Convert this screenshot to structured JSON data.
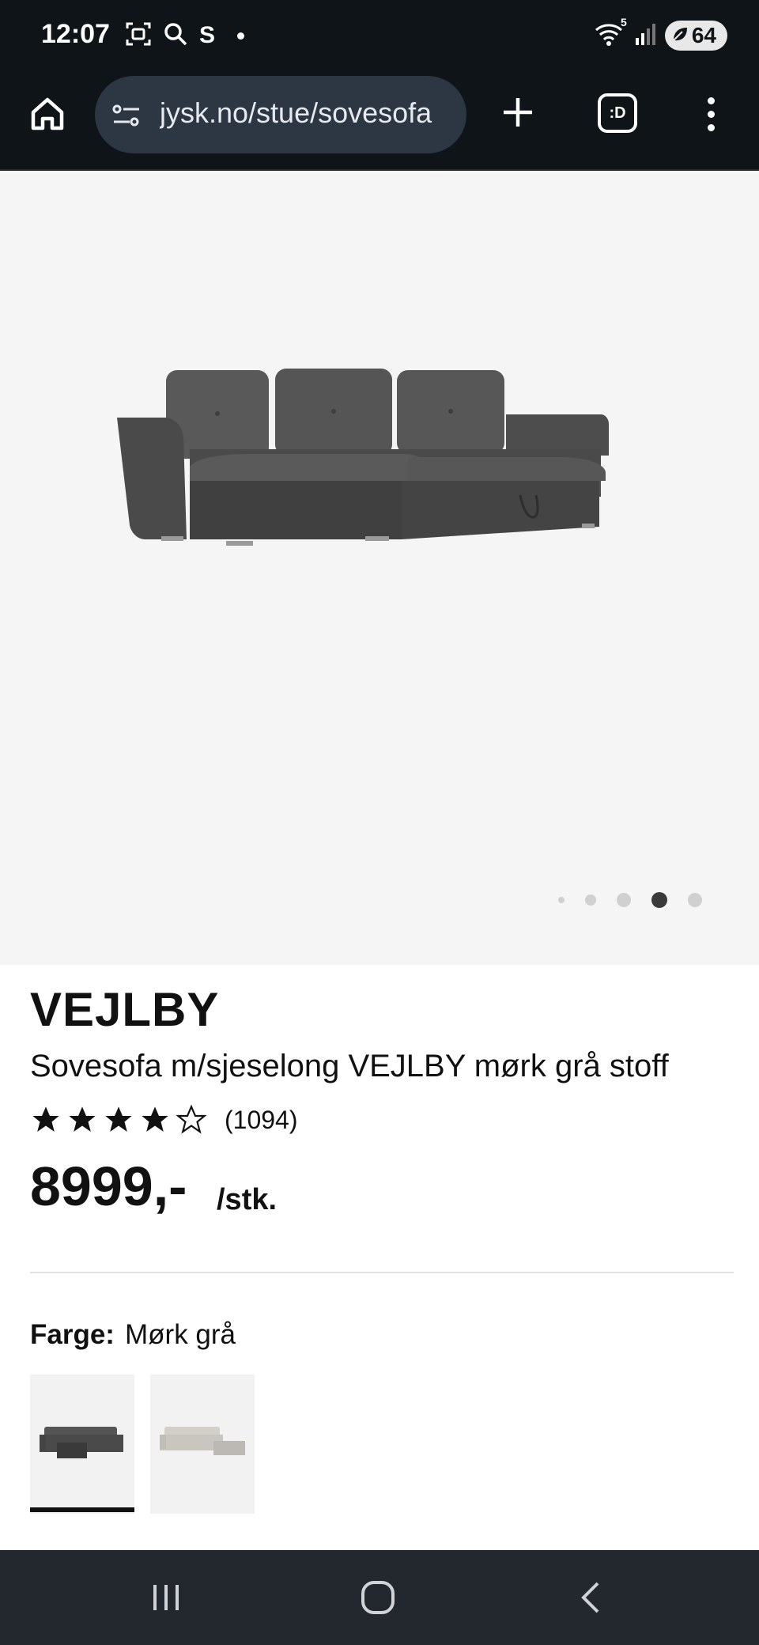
{
  "status_bar": {
    "time": "12:07",
    "app_icon_letter": "S",
    "wifi_badge": "5",
    "battery": "64"
  },
  "browser": {
    "url": "jysk.no/stue/sovesofa",
    "tab_count_label": ":D"
  },
  "gallery": {
    "page_count": 5,
    "active_index": 3
  },
  "product": {
    "name": "VEJLBY",
    "description": "Sovesofa m/sjeselong VEJLBY mørk grå stoff",
    "rating": 4,
    "rating_max": 5,
    "review_count": "(1094)",
    "price": "8999,-",
    "unit": "/stk.",
    "color_label": "Farge:",
    "color_value": "Mørk grå"
  },
  "colors": {
    "chrome": "#0f1419",
    "url_pill": "#2d3744",
    "gallery_bg": "#f5f5f5",
    "sofa_dark": "#4a4a4a",
    "sofa_light": "#c9c6c0"
  }
}
